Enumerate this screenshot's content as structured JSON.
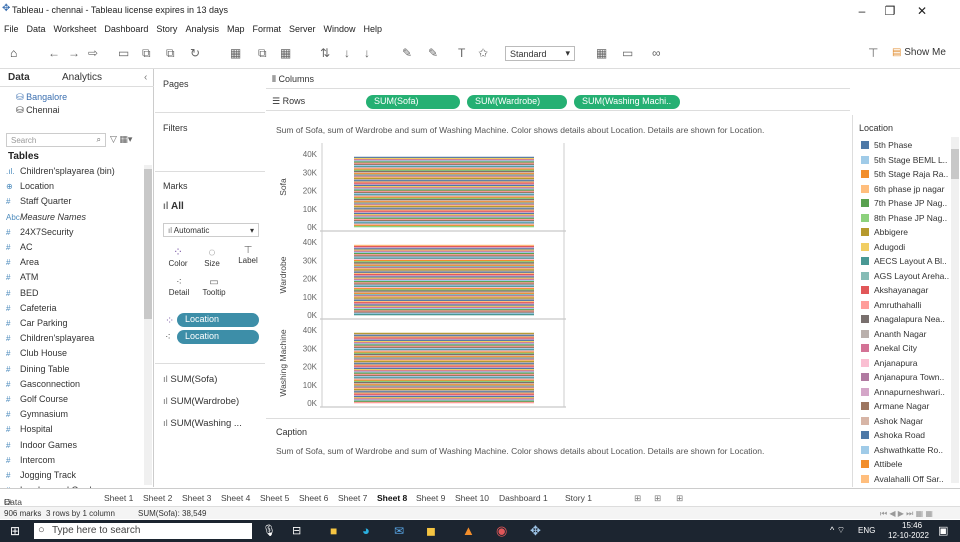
{
  "window": {
    "title": "Tableau - chennai - Tableau license expires in 13 days"
  },
  "menu": [
    "File",
    "Data",
    "Worksheet",
    "Dashboard",
    "Story",
    "Analysis",
    "Map",
    "Format",
    "Server",
    "Window",
    "Help"
  ],
  "toolbar": {
    "view_size": "Standard",
    "show_me": "Show Me"
  },
  "data_pane": {
    "tab_data": "Data",
    "tab_analytics": "Analytics",
    "sources": [
      "Bangalore",
      "Chennai"
    ],
    "search_placeholder": "Search",
    "tables_header": "Tables",
    "fields": [
      {
        "type": ".ıl.",
        "name": "Children'splayarea (bin)"
      },
      {
        "type": "⊕",
        "name": "Location"
      },
      {
        "type": "#",
        "name": "Staff Quarter"
      },
      {
        "type": "Abc",
        "name": "Measure Names"
      },
      {
        "type": "#",
        "name": "24X7Security"
      },
      {
        "type": "#",
        "name": "AC"
      },
      {
        "type": "#",
        "name": "Area"
      },
      {
        "type": "#",
        "name": "ATM"
      },
      {
        "type": "#",
        "name": "BED"
      },
      {
        "type": "#",
        "name": "Cafeteria"
      },
      {
        "type": "#",
        "name": "Car Parking"
      },
      {
        "type": "#",
        "name": "Children'splayarea"
      },
      {
        "type": "#",
        "name": "Club House"
      },
      {
        "type": "#",
        "name": "Dining Table"
      },
      {
        "type": "#",
        "name": "Gasconnection"
      },
      {
        "type": "#",
        "name": "Golf Course"
      },
      {
        "type": "#",
        "name": "Gymnasium"
      },
      {
        "type": "#",
        "name": "Hospital"
      },
      {
        "type": "#",
        "name": "Indoor Games"
      },
      {
        "type": "#",
        "name": "Intercom"
      },
      {
        "type": "#",
        "name": "Jogging Track"
      },
      {
        "type": "#",
        "name": "Landscaped Gardens"
      }
    ]
  },
  "pages": {
    "title": "Pages"
  },
  "filters": {
    "title": "Filters"
  },
  "marks": {
    "title": "Marks",
    "all": "All",
    "mark_type": "Automatic",
    "buttons": [
      "Color",
      "Size",
      "Label",
      "Detail",
      "Tooltip"
    ],
    "pills": [
      "Location",
      "Location"
    ],
    "measures": [
      "SUM(Sofa)",
      "SUM(Wardrobe)",
      "SUM(Washing ..."
    ]
  },
  "shelves": {
    "columns": "Columns",
    "rows": "Rows",
    "row_pills": [
      "SUM(Sofa)",
      "SUM(Wardrobe)",
      "SUM(Washing Machi.."
    ]
  },
  "viz": {
    "description": "Sum of Sofa, sum of Wardrobe and sum of Washing Machine.  Color shows details about Location.  Details are shown for Location."
  },
  "chart_data": {
    "type": "bar",
    "panels": [
      {
        "name": "Sofa",
        "ylim": [
          0,
          45000
        ],
        "ticks": [
          "40K",
          "30K",
          "20K",
          "10K",
          "0K"
        ]
      },
      {
        "name": "Wardrobe",
        "ylim": [
          0,
          45000
        ],
        "ticks": [
          "40K",
          "30K",
          "20K",
          "10K",
          "0K"
        ]
      },
      {
        "name": "Washing Machine",
        "ylim": [
          0,
          45000
        ],
        "ticks": [
          "40K",
          "30K",
          "20K",
          "10K",
          "0K"
        ]
      }
    ],
    "total": 38549,
    "stacked_by": "Location"
  },
  "caption": {
    "title": "Caption",
    "text": "Sum of Sofa, sum of Wardrobe and sum of Washing Machine.  Color shows details about Location.  Details are shown for Location."
  },
  "legend": {
    "title": "Location",
    "items": [
      {
        "label": "5th Phase",
        "color": "#4e79a7"
      },
      {
        "label": "5th Stage BEML L..",
        "color": "#a0cbe8"
      },
      {
        "label": "5th Stage Raja Ra..",
        "color": "#f28e2b"
      },
      {
        "label": "6th phase jp nagar",
        "color": "#ffbe7d"
      },
      {
        "label": "7th Phase JP Nag..",
        "color": "#59a14f"
      },
      {
        "label": "8th Phase JP Nag..",
        "color": "#8cd17d"
      },
      {
        "label": "Abbigere",
        "color": "#b6992d"
      },
      {
        "label": "Adugodi",
        "color": "#f1ce63"
      },
      {
        "label": "AECS Layout A Bl..",
        "color": "#499894"
      },
      {
        "label": "AGS Layout Areha..",
        "color": "#86bcb6"
      },
      {
        "label": "Akshayanagar",
        "color": "#e15759"
      },
      {
        "label": "Amruthahalli",
        "color": "#ff9d9a"
      },
      {
        "label": "Anagalapura Nea..",
        "color": "#79706e"
      },
      {
        "label": "Ananth Nagar",
        "color": "#bab0ac"
      },
      {
        "label": "Anekal City",
        "color": "#d37295"
      },
      {
        "label": "Anjanapura",
        "color": "#fabfd2"
      },
      {
        "label": "Anjanapura Town..",
        "color": "#b07aa1"
      },
      {
        "label": "Annapurneshwari..",
        "color": "#d4a6c8"
      },
      {
        "label": "Armane Nagar",
        "color": "#9d7660"
      },
      {
        "label": "Ashok Nagar",
        "color": "#d7b5a6"
      },
      {
        "label": "Ashoka Road",
        "color": "#4e79a7"
      },
      {
        "label": "Ashwathkatte Ro..",
        "color": "#a0cbe8"
      },
      {
        "label": "Attibele",
        "color": "#f28e2b"
      },
      {
        "label": "Avalahalli Off Sar..",
        "color": "#ffbe7d"
      }
    ]
  },
  "sheet_tabs": {
    "data_source": "Data Source",
    "tabs": [
      "Sheet 1",
      "Sheet 2",
      "Sheet 3",
      "Sheet 4",
      "Sheet 5",
      "Sheet 6",
      "Sheet 7",
      "Sheet 8",
      "Sheet 9",
      "Sheet 10",
      "Dashboard 1",
      "Story 1"
    ],
    "active": "Sheet 8"
  },
  "status": {
    "marks": "906 marks",
    "layout": "3 rows by 1 column",
    "sum": "SUM(Sofa): 38,549"
  },
  "taskbar": {
    "search": "Type here to search",
    "lang": "ENG",
    "time": "15:46",
    "date": "12-10-2022"
  }
}
